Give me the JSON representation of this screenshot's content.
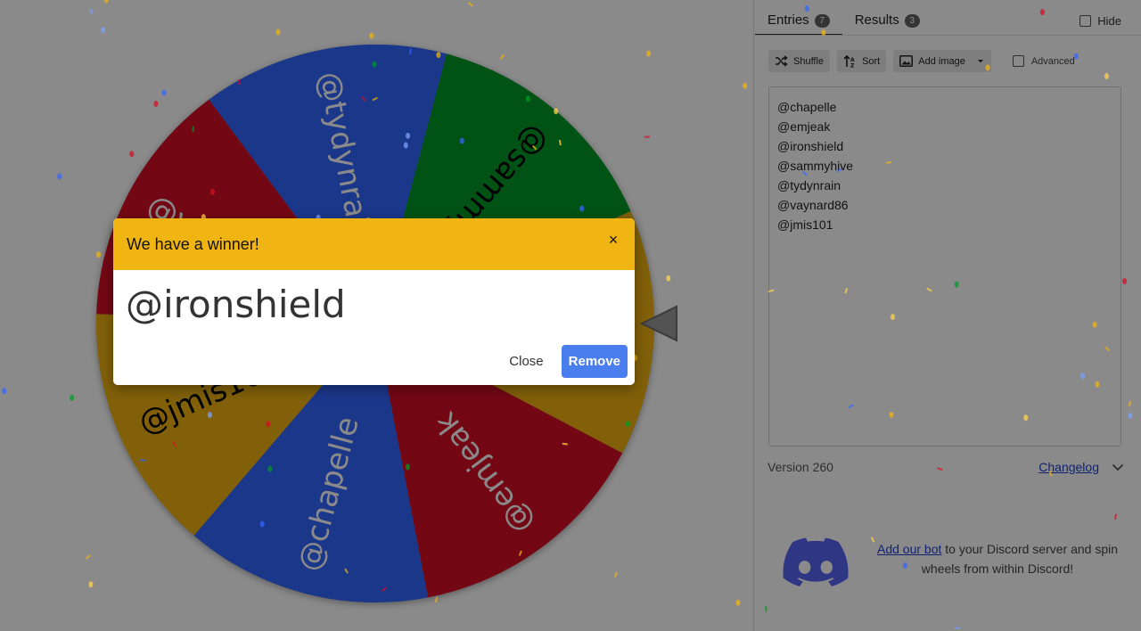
{
  "wheel": {
    "segments": [
      {
        "label": "@tydynrain",
        "color": "#3366ff",
        "dark": false
      },
      {
        "label": "@sammyhive",
        "color": "#009925",
        "dark": true
      },
      {
        "label": "@ironshield",
        "color": "#eeb211",
        "dark": true
      },
      {
        "label": "@emjeak",
        "color": "#d50f25",
        "dark": false
      },
      {
        "label": "@chapelle",
        "color": "#3366ff",
        "dark": false
      },
      {
        "label": "@jmis101",
        "color": "#eeb211",
        "dark": true
      },
      {
        "label": "@vaynard86",
        "color": "#d50f25",
        "dark": false
      }
    ]
  },
  "tabs": [
    {
      "label": "Entries",
      "count": "7"
    },
    {
      "label": "Results",
      "count": "3"
    }
  ],
  "hide_label": "Hide",
  "toolbar": {
    "shuffle": "Shuffle",
    "sort": "Sort",
    "add_image": "Add image",
    "advanced": "Advanced"
  },
  "entries": [
    "@chapelle",
    "@emjeak",
    "@ironshield",
    "@sammyhive",
    "@tydynrain",
    "@vaynard86",
    "@jmis101"
  ],
  "version": "Version 260",
  "changelog": "Changelog",
  "discord": {
    "link": "Add our bot",
    "text": " to your Discord server and spin wheels from within Discord!"
  },
  "dialog": {
    "title": "We have a winner!",
    "close_icon": "×",
    "winner": "@ironshield",
    "close_label": "Close",
    "remove_label": "Remove"
  },
  "colors": {
    "header": "#f0b512",
    "remove_button": "#4a7ded",
    "link": "#1a3fd0"
  }
}
